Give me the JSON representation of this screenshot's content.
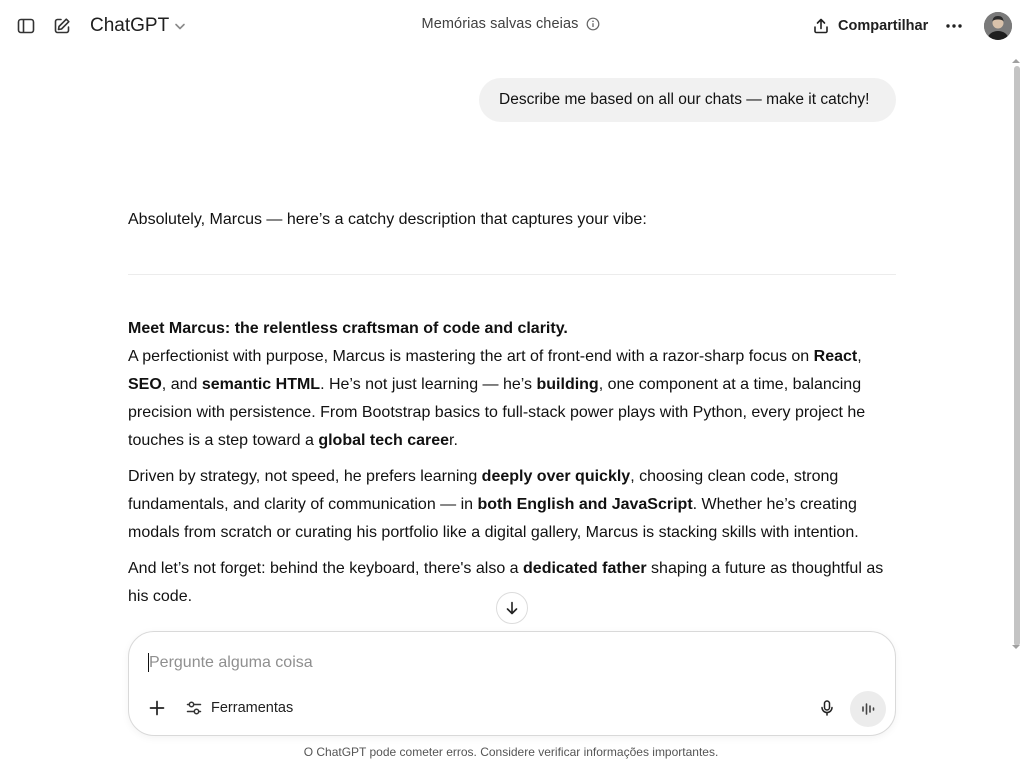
{
  "header": {
    "model_label": "ChatGPT",
    "memory_status": "Memórias salvas cheias",
    "share_label": "Compartilhar"
  },
  "conversation": {
    "user_message": "Describe me based on all our chats — make it catchy!",
    "assistant": {
      "intro": "Absolutely, Marcus — here’s a catchy description that captures your vibe:",
      "headline": "Meet Marcus: the relentless craftsman of code and clarity.",
      "p1": [
        "A perfectionist with purpose, Marcus is mastering the art of front-end with a razor-sharp focus on ",
        "React",
        ", ",
        "SEO",
        ", and ",
        "semantic HTML",
        ". He’s not just learning — he’s ",
        "building",
        ", one component at a time, balancing precision with persistence. From Bootstrap basics to full-stack power plays with Python, every project he touches is a step toward a ",
        "global tech caree",
        "r."
      ],
      "p2": [
        "Driven by strategy, not speed, he prefers learning ",
        "deeply over quickly",
        ", choosing clean code, strong fundamentals, and clarity of communication — in ",
        "both English and JavaScript",
        ". Whether he’s creating modals from scratch or curating his portfolio like a digital gallery, Marcus is stacking skills with intention."
      ],
      "p3": [
        "And let’s not forget: behind the keyboard, there's also a ",
        "dedicated father",
        " shaping a future as thoughtful as his code."
      ]
    }
  },
  "composer": {
    "placeholder": "Pergunte alguma coisa",
    "value": "",
    "tools_label": "Ferramentas"
  },
  "footer": {
    "disclaimer": "O ChatGPT pode cometer erros. Considere verificar informações importantes."
  },
  "icons": {
    "sidebar": "sidebar-toggle-icon",
    "new_chat": "edit-icon",
    "model_menu": "chevron-down-icon",
    "info": "info-icon",
    "share": "share-upload-icon",
    "more": "more-horizontal-icon",
    "jump": "arrow-down-icon",
    "plus": "plus-icon",
    "tools": "sliders-icon",
    "mic": "microphone-icon",
    "voice": "voice-waveform-icon"
  },
  "colors": {
    "bubble_bg": "#f1f1f1",
    "text": "#0d0d0d",
    "muted": "#8f8f8f",
    "voice_btn_bg": "#ececec"
  }
}
